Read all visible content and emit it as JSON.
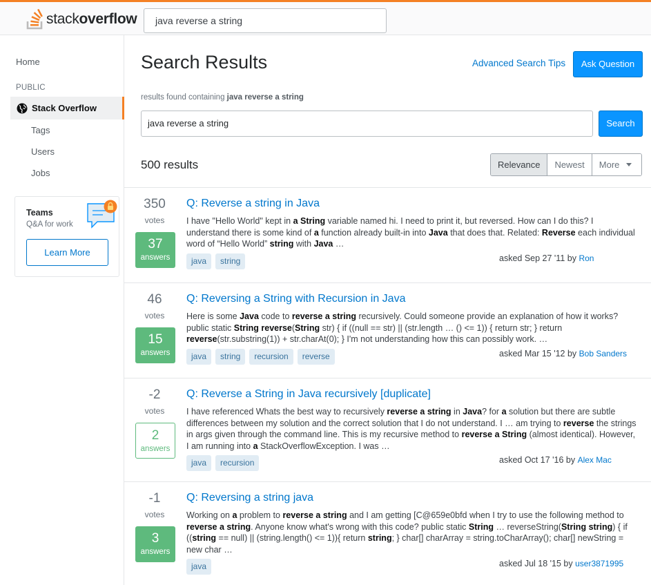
{
  "header": {
    "logo_light": "stack",
    "logo_bold": "overflow",
    "search_value": "java reverse a string"
  },
  "sidebar": {
    "home": "Home",
    "public_label": "PUBLIC",
    "stack_overflow": "Stack Overflow",
    "tags": "Tags",
    "users": "Users",
    "jobs": "Jobs",
    "teams_title": "Teams",
    "teams_sub": "Q&A for work",
    "learn_more": "Learn More"
  },
  "main": {
    "title": "Search Results",
    "advanced_tips": "Advanced Search Tips",
    "ask_question": "Ask Question",
    "results_found_prefix": "results found containing",
    "results_found_query": "java reverse a string",
    "search_value": "java reverse a string",
    "search_button": "Search",
    "result_count": "500 results",
    "sort": [
      "Relevance",
      "Newest",
      "More"
    ],
    "votes_label": "votes",
    "answers_label": "answers"
  },
  "results": [
    {
      "votes": "350",
      "answers": "37",
      "accepted": true,
      "title": "Q: Reverse a string in Java",
      "excerpt_html": "I have \"Hello World\" kept in <b>a</b> <b>String</b> variable named hi. I need to print it, but reversed. How can I do this? I understand there is some kind of <b>a</b> function already built-in into <b>Java</b> that does that. Related: <b>Reverse</b> each individual word of “Hello World” <b>string</b> with <b>Java</b> …",
      "tags": [
        "java",
        "string"
      ],
      "asked": "asked Sep 27 '11 by",
      "user": "Ron"
    },
    {
      "votes": "46",
      "answers": "15",
      "accepted": true,
      "title": "Q: Reversing a String with Recursion in Java",
      "excerpt_html": "Here is some <b>Java</b> code to <b>reverse</b> <b>a</b> <b>string</b> recursively. Could someone provide an explanation of how it works? public static <b>String</b> <b>reverse</b>(<b>String</b> str) { if ((null == str) || (str.length … () &lt;= 1)) { return str; } return <b>reverse</b>(str.substring(1)) + str.charAt(0); } I'm not understanding how this can possibly work. …",
      "tags": [
        "java",
        "string",
        "recursion",
        "reverse"
      ],
      "asked": "asked Mar 15 '12 by",
      "user": "Bob Sanders"
    },
    {
      "votes": "-2",
      "answers": "2",
      "accepted": false,
      "title": "Q: Reverse a String in Java recursively [duplicate]",
      "excerpt_html": "I have referenced Whats the best way to recursively <b>reverse</b> <b>a</b> <b>string</b> in <b>Java</b>? for <b>a</b> solution but there are subtle differences between my solution and the correct solution that I do not understand. I … am trying to <b>reverse</b> the strings in args given through the command line. This is my recursive method to <b>reverse</b> <b>a</b> <b>String</b> (almost identical). However, I am running into <b>a</b> StackOverflowException. I was …",
      "tags": [
        "java",
        "recursion"
      ],
      "asked": "asked Oct 17 '16 by",
      "user": "Alex Mac"
    },
    {
      "votes": "-1",
      "answers": "3",
      "accepted": true,
      "title": "Q: Reversing a string java",
      "excerpt_html": "Working on <b>a</b> problem to <b>reverse</b> <b>a</b> <b>string</b> and I am getting [C@659e0bfd when I try to use the following method to <b>reverse</b> <b>a</b> <b>string</b>. Anyone know what's wrong with this code? public static <b>String</b> … reverseString(<b>String</b> <b>string</b>) { if ((<b>string</b> == null) || (string.length() &lt;= 1)){ return <b>string</b>; } char[] charArray = string.toCharArray(); char[] newString = new char …",
      "tags": [
        "java"
      ],
      "asked": "asked Jul 18 '15 by",
      "user": "user3871995"
    }
  ],
  "colors": {
    "brand_orange": "#f48024",
    "link_blue": "#0077cc",
    "button_blue": "#0a95ff",
    "answer_green": "#5eba7d",
    "tag_bg": "#e1ecf4",
    "tag_text": "#39739d"
  }
}
